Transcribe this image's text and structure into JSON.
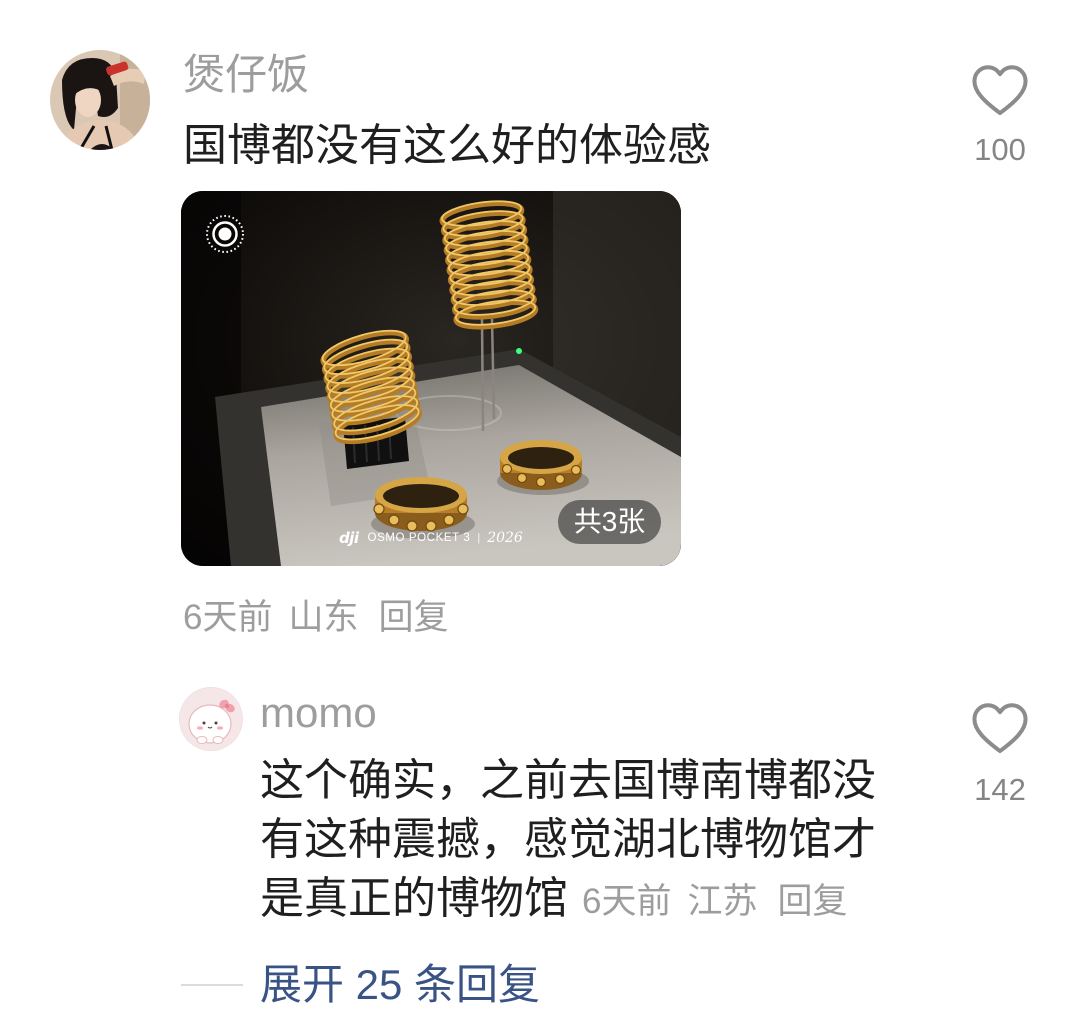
{
  "colors": {
    "background": "#ffffff",
    "primary_text": "#1f1f1f",
    "secondary_text": "#9d9d9d",
    "like_icon": "#8c8c8c",
    "expand_link": "#3a5385"
  },
  "icons": {
    "like": "heart-icon",
    "live_photo": "live-photo-icon"
  },
  "comment": {
    "username": "煲仔饭",
    "text": "国博都没有这么好的体验感",
    "likes": "100",
    "image": {
      "badge": "共3张",
      "watermark": {
        "brand": "dji",
        "model": "OSMO POCKET 3",
        "separator": "|",
        "year": "2026"
      }
    },
    "meta": {
      "time": "6天前",
      "location": "山东",
      "reply": "回复"
    }
  },
  "reply": {
    "username": "momo",
    "text": "这个确实，之前去国博南博都没有这种震撼，感觉湖北博物馆才是真正的博物馆",
    "likes": "142",
    "meta": {
      "time": "6天前",
      "location": "江苏",
      "reply": "回复"
    }
  },
  "expand_replies": "展开 25 条回复"
}
